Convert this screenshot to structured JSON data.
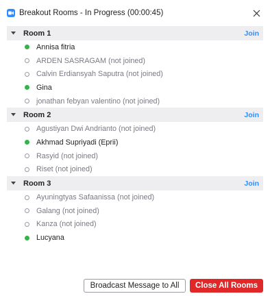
{
  "window": {
    "title": "Breakout Rooms - In Progress (00:00:45)",
    "app_icon": "zoom-camera-icon",
    "close_icon": "close-icon"
  },
  "rooms": [
    {
      "name": "Room 1",
      "join_label": "Join",
      "members": [
        {
          "name": "Annisa fitria",
          "joined": true
        },
        {
          "name": "ARDEN  SASRAGAM (not joined)",
          "joined": false
        },
        {
          "name": "Calvin Erdiansyah Saputra (not joined)",
          "joined": false
        },
        {
          "name": "Gina",
          "joined": true
        },
        {
          "name": "jonathan febyan valentino (not joined)",
          "joined": false
        }
      ]
    },
    {
      "name": "Room 2",
      "join_label": "Join",
      "members": [
        {
          "name": "Agustiyan Dwi Andrianto (not joined)",
          "joined": false
        },
        {
          "name": "Akhmad Supriyadi (Eprii)",
          "joined": true
        },
        {
          "name": "Rasyid (not joined)",
          "joined": false
        },
        {
          "name": "Riset (not joined)",
          "joined": false
        }
      ]
    },
    {
      "name": "Room 3",
      "join_label": "Join",
      "members": [
        {
          "name": "Ayuningtyas Safaanissa (not joined)",
          "joined": false
        },
        {
          "name": "Galang (not joined)",
          "joined": false
        },
        {
          "name": "Kanza (not joined)",
          "joined": false
        },
        {
          "name": "Lucyana",
          "joined": true
        }
      ]
    }
  ],
  "footer": {
    "broadcast_label": "Broadcast Message to All",
    "close_all_label": "Close All Rooms"
  },
  "colors": {
    "accent": "#2d8cff",
    "danger": "#e02828",
    "joined_dot": "#35b24a",
    "room_header_bg": "#eeeef0"
  }
}
